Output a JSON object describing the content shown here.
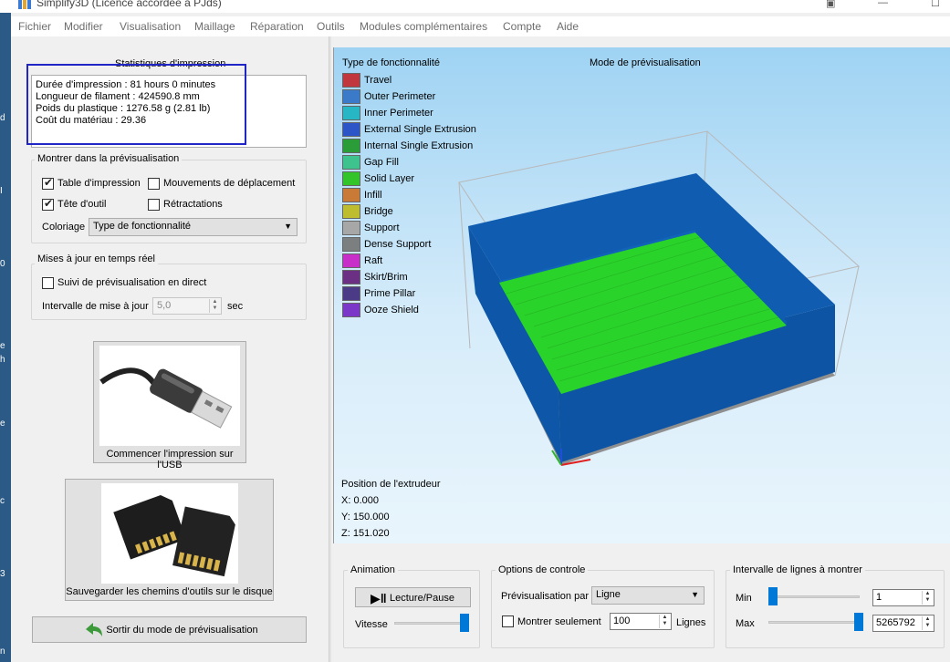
{
  "window": {
    "title": "Simplify3D (Licence accordée à PJds)"
  },
  "menu": [
    "Fichier",
    "Modifier",
    "Visualisation",
    "Maillage",
    "Réparation",
    "Outils",
    "Modules complémentaires",
    "Compte",
    "Aide"
  ],
  "stats": {
    "title": "Statistiques d'impression",
    "lines": [
      "Durée d'impression : 81 hours 0 minutes",
      "Longueur de filament : 424590.8 mm",
      "Poids du plastique : 1276.58 g (2.81 lb)",
      "Coût du matériau : 29.36"
    ]
  },
  "show_panel": {
    "title": "Montrer dans la prévisualisation",
    "table_label": "Table d'impression",
    "table_checked": true,
    "travel_label": "Mouvements de déplacement",
    "travel_checked": false,
    "tool_head_label": "Tête d'outil",
    "tool_head_checked": true,
    "retract_label": "Rétractations",
    "retract_checked": false,
    "coloring_label": "Coloriage",
    "coloring_value": "Type de fonctionnalité"
  },
  "realtime_panel": {
    "title": "Mises à jour en temps réel",
    "live_label": "Suivi de prévisualisation en direct",
    "live_checked": false,
    "interval_label": "Intervalle de mise à jour",
    "interval_value": "5,0",
    "interval_unit": "sec"
  },
  "buttons": {
    "usb": "Commencer l'impression sur l'USB",
    "sd": "Sauvegarder les chemins d'outils sur le disque",
    "exit": "Sortir du mode de prévisualisation"
  },
  "preview": {
    "mode_title": "Mode de prévisualisation",
    "legend_title": "Type de fonctionnalité",
    "legend": [
      {
        "label": "Travel",
        "color": "#c0383e"
      },
      {
        "label": "Outer Perimeter",
        "color": "#3b79c9"
      },
      {
        "label": "Inner Perimeter",
        "color": "#27b6c3"
      },
      {
        "label": "External Single Extrusion",
        "color": "#2c55c8"
      },
      {
        "label": "Internal Single Extrusion",
        "color": "#2a9c38"
      },
      {
        "label": "Gap Fill",
        "color": "#3ec38e"
      },
      {
        "label": "Solid Layer",
        "color": "#32c428"
      },
      {
        "label": "Infill",
        "color": "#c87a36"
      },
      {
        "label": "Bridge",
        "color": "#bdbd2f"
      },
      {
        "label": "Support",
        "color": "#a7a7a7"
      },
      {
        "label": "Dense Support",
        "color": "#7c7f80"
      },
      {
        "label": "Raft",
        "color": "#c82fc8"
      },
      {
        "label": "Skirt/Brim",
        "color": "#6b2f83"
      },
      {
        "label": "Prime Pillar",
        "color": "#4b3a86"
      },
      {
        "label": "Ooze Shield",
        "color": "#7a37c8"
      }
    ],
    "extruder_title": "Position de l'extrudeur",
    "x": "X: 0.000",
    "y": "Y: 150.000",
    "z": "Z: 151.020"
  },
  "animation": {
    "title": "Animation",
    "play_label": "Lecture/Pause",
    "speed_label": "Vitesse",
    "speed_fraction": 1.0
  },
  "control": {
    "title": "Options de controle",
    "preview_by_label": "Prévisualisation par",
    "preview_by_value": "Ligne",
    "only_show_label": "Montrer seulement",
    "only_show_checked": false,
    "only_show_value": "100",
    "only_show_unit": "Lignes"
  },
  "range": {
    "title": "Intervalle de lignes à montrer",
    "min_label": "Min",
    "min_value": "1",
    "max_label": "Max",
    "max_value": "5265792",
    "min_fraction": 0.0,
    "max_fraction": 1.0
  }
}
